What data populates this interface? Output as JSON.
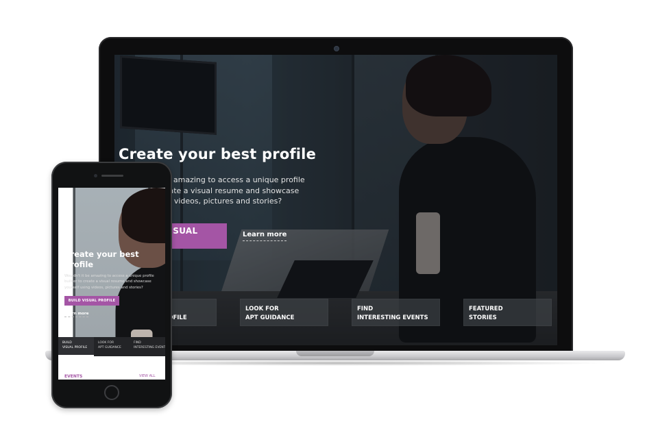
{
  "laptop": {
    "hero": {
      "title": "Create your best profile",
      "text": "Wouldn't it be amazing to access a unique profile builder to create a visual resume and showcase yourself using videos, pictures and stories?",
      "button": "BUILD VISUAL PROFILE",
      "link": "Learn more"
    },
    "cards": [
      {
        "line1": "BUILD",
        "line2": "VISUAL PROFILE"
      },
      {
        "line1": "LOOK FOR",
        "line2": "APT GUIDANCE"
      },
      {
        "line1": "FIND",
        "line2": "INTERESTING EVENTS"
      },
      {
        "line1": "FEATURED",
        "line2": "STORIES"
      }
    ]
  },
  "phone": {
    "hero": {
      "title": "Create your best profile",
      "text": "Wouldn't it be amazing to access a unique profile builder to create a visual resume and showcase yourself using videos, pictures and stories?",
      "button": "BUILD VISUAL PROFILE",
      "link": "Learn more"
    },
    "tabs": [
      {
        "line1": "BUILD",
        "line2": "VISUAL PROFILE"
      },
      {
        "line1": "LOOK FOR",
        "line2": "APT GUIDANCE"
      },
      {
        "line1": "FIND",
        "line2": "INTERESTING EVENTS"
      }
    ],
    "events": {
      "title": "EVENTS",
      "link": "VIEW ALL"
    }
  },
  "colors": {
    "accent": "#a455a5",
    "dark": "#111213"
  }
}
